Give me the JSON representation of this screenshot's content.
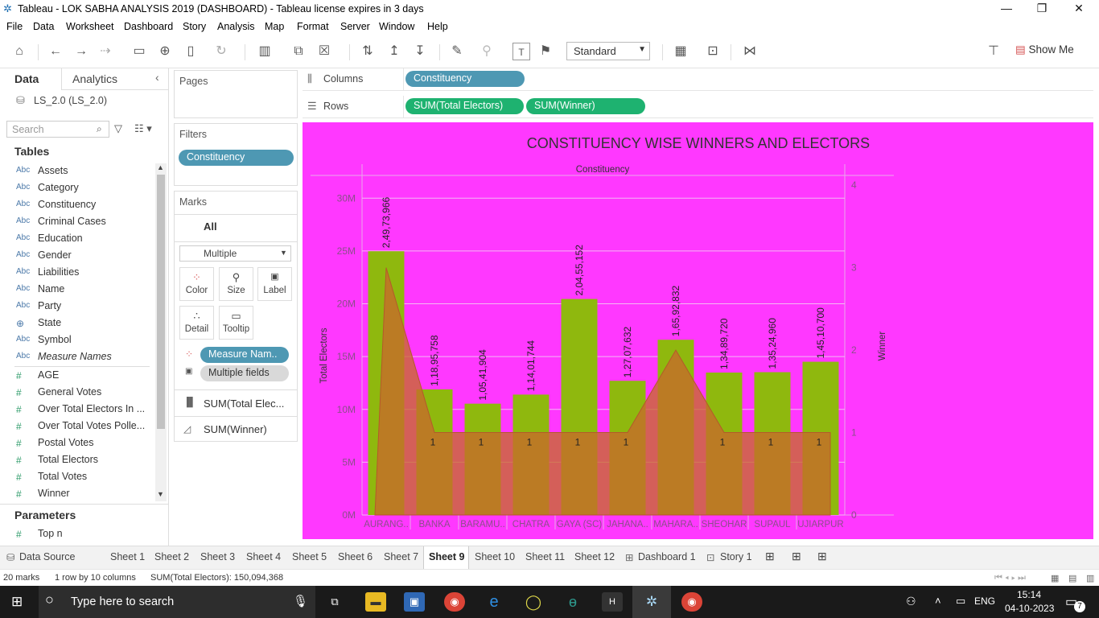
{
  "window": {
    "title": "Tableau - LOK SABHA ANALYSIS 2019 (DASHBOARD) - Tableau license expires in 3 days"
  },
  "menu": [
    "File",
    "Data",
    "Worksheet",
    "Dashboard",
    "Story",
    "Analysis",
    "Map",
    "Format",
    "Server",
    "Window",
    "Help"
  ],
  "toolbar": {
    "fit_select": "Standard",
    "show_me": "Show Me"
  },
  "data_pane": {
    "tab_data": "Data",
    "tab_analytics": "Analytics",
    "datasource": "LS_2.0 (LS_2.0)",
    "search_placeholder": "Search",
    "tables_header": "Tables",
    "dimensions": [
      "Assets",
      "Category",
      "Constituency",
      "Criminal Cases",
      "Education",
      "Gender",
      "Liabilities",
      "Name",
      "Party",
      "State",
      "Symbol",
      "Measure Names"
    ],
    "measures": [
      "AGE",
      "General Votes",
      "Over Total Electors  In ...",
      "Over Total Votes Polle...",
      "Postal Votes",
      "Total Electors",
      "Total Votes",
      "Winner"
    ],
    "parameters_header": "Parameters",
    "parameters": [
      "Top n"
    ]
  },
  "pages": {
    "title": "Pages"
  },
  "filters": {
    "title": "Filters",
    "items": [
      "Constituency"
    ]
  },
  "marks": {
    "title": "Marks",
    "all": "All",
    "type": "Multiple",
    "buttons": [
      "Color",
      "Size",
      "Label",
      "Detail",
      "Tooltip"
    ],
    "pills": [
      "Measure Nam..",
      "Multiple fields"
    ],
    "layers": [
      "SUM(Total Elec...",
      "SUM(Winner)"
    ]
  },
  "shelves": {
    "columns_label": "Columns",
    "columns": [
      "Constituency"
    ],
    "rows_label": "Rows",
    "rows": [
      "SUM(Total Electors)",
      "SUM(Winner)"
    ]
  },
  "colors": {
    "background": "#ff38ff",
    "bar": "#8fb80e",
    "area": "#c86a2a",
    "pill_blue": "#4e98b3",
    "pill_green": "#1eb270"
  },
  "chart_data": {
    "type": "bar",
    "title": "CONSTITUENCY WISE WINNERS AND ELECTORS",
    "xlabel": "Constituency",
    "ylabel": "Total Electors",
    "y2label": "Winner",
    "ylim": [
      0,
      32000000
    ],
    "y2lim": [
      0,
      4.1
    ],
    "yticks": [
      "0M",
      "5M",
      "10M",
      "15M",
      "20M",
      "25M",
      "30M"
    ],
    "y2ticks": [
      "0",
      "1",
      "2",
      "3",
      "4"
    ],
    "categories": [
      "AURANG..",
      "BANKA",
      "BARAMU..",
      "CHATRA",
      "GAYA (SC)",
      "JAHANA..",
      "MAHARA..",
      "SHEOHAR",
      "SUPAUL",
      "UJIARPUR"
    ],
    "series": [
      {
        "name": "SUM(Total Electors)",
        "type": "bar",
        "values": [
          24973966,
          11895758,
          10541904,
          11401744,
          20455152,
          12707632,
          16592832,
          13489720,
          13524960,
          14510700
        ],
        "labels": [
          "2,49,73,966",
          "1,18,95,758",
          "1,05,41,904",
          "1,14,01,744",
          "2,04,55,152",
          "1,27,07,632",
          "1,65,92,832",
          "1,34,89,720",
          "1,35,24,960",
          "1,45,10,700"
        ]
      },
      {
        "name": "SUM(Winner)",
        "type": "area",
        "values": [
          3,
          1,
          1,
          1,
          1,
          1,
          2,
          1,
          1,
          1
        ],
        "labels": [
          "3",
          "1",
          "1",
          "1",
          "1",
          "1",
          "2",
          "1",
          "1",
          "1"
        ]
      }
    ]
  },
  "sheet_tabs": [
    "Data Source",
    "Sheet 1",
    "Sheet 2",
    "Sheet 3",
    "Sheet 4",
    "Sheet 5",
    "Sheet 6",
    "Sheet 7",
    "Sheet 9",
    "Sheet 10",
    "Sheet 11",
    "Sheet 12",
    "Dashboard 1",
    "Story 1"
  ],
  "active_tab": "Sheet 9",
  "status": {
    "marks": "20 marks",
    "rows": "1 row by 10 columns",
    "sum": "SUM(Total Electors): 150,094,368"
  },
  "taskbar": {
    "search_placeholder": "Type here to search",
    "lang": "ENG",
    "time": "15:14",
    "date": "04-10-2023",
    "notif": "7"
  }
}
